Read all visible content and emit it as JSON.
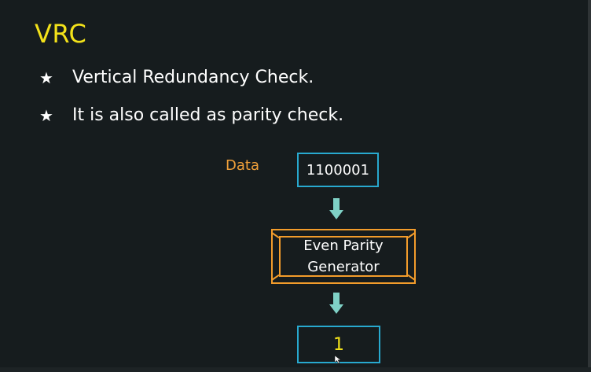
{
  "slide": {
    "title": "VRC",
    "bullets": [
      {
        "icon": "star-icon",
        "text": "Vertical Redundancy Check."
      },
      {
        "icon": "star-icon",
        "text": "It is also called as parity check."
      }
    ]
  },
  "diagram": {
    "data_label": "Data",
    "data_value": "1100001",
    "generator_line1": "Even Parity",
    "generator_line2": "Generator",
    "output_value": "1"
  },
  "colors": {
    "background": "#161c1e",
    "title": "#f3e21a",
    "data_label": "#f0a03a",
    "box_border": "#28a9cf",
    "generator_border": "#f39c2b",
    "arrow": "#7fd1c6",
    "output_value": "#f3e21a"
  }
}
